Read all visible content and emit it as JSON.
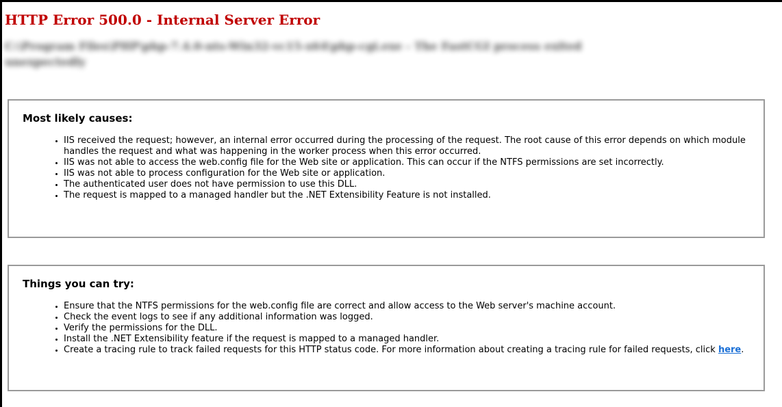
{
  "page": {
    "title": "HTTP Error 500.0 - Internal Server Error",
    "blurred_message_line1": "C:\\Program Files\\PHP\\php-7.4.0-nts-Win32-vc15-x64\\php-cgi.exe - The FastCGI process exited",
    "blurred_message_line2": "unexpectedly"
  },
  "causes": {
    "heading": "Most likely causes:",
    "items": [
      "IIS received the request; however, an internal error occurred during the processing of the request. The root cause of this error depends on which module handles the request and what was happening in the worker process when this error occurred.",
      "IIS was not able to access the web.config file for the Web site or application. This can occur if the NTFS permissions are set incorrectly.",
      "IIS was not able to process configuration for the Web site or application.",
      "The authenticated user does not have permission to use this DLL.",
      "The request is mapped to a managed handler but the .NET Extensibility Feature is not installed."
    ]
  },
  "try": {
    "heading": "Things you can try:",
    "items": [
      "Ensure that the NTFS permissions for the web.config file are correct and allow access to the Web server's machine account.",
      "Check the event logs to see if any additional information was logged.",
      "Verify the permissions for the DLL.",
      "Install the .NET Extensibility feature if the request is mapped to a managed handler."
    ],
    "last_item_text": "Create a tracing rule to track failed requests for this HTTP status code. For more information about creating a tracing rule for failed requests, click",
    "link_text": "here",
    "last_item_suffix": "."
  },
  "colors": {
    "title": "#c00000",
    "link": "#1a6fd6",
    "panel_border": "#9a9a9a"
  }
}
